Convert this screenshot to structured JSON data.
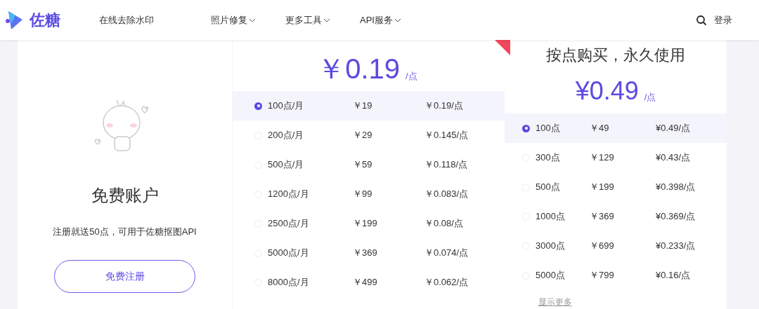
{
  "header": {
    "brand": "佐糖",
    "nav": [
      {
        "label": "在线去除水印",
        "dropdown": false
      },
      {
        "label": "照片修复",
        "dropdown": true
      },
      {
        "label": "更多工具",
        "dropdown": true
      },
      {
        "label": "API服务",
        "dropdown": true
      }
    ],
    "login": "登录"
  },
  "free_card": {
    "title": "免费账户",
    "description": "注册就送50点，可用于佐糖抠图API",
    "button": "免费注册"
  },
  "monthly_card": {
    "price": "￥0.19",
    "unit": "/点",
    "rows": [
      {
        "points": "100点/月",
        "price": "￥19",
        "per_point": "￥0.19/点",
        "selected": true
      },
      {
        "points": "200点/月",
        "price": "￥29",
        "per_point": "￥0.145/点",
        "selected": false
      },
      {
        "points": "500点/月",
        "price": "￥59",
        "per_point": "￥0.118/点",
        "selected": false
      },
      {
        "points": "1200点/月",
        "price": "￥99",
        "per_point": "￥0.083/点",
        "selected": false
      },
      {
        "points": "2500点/月",
        "price": "￥199",
        "per_point": "￥0.08/点",
        "selected": false
      },
      {
        "points": "5000点/月",
        "price": "￥369",
        "per_point": "￥0.074/点",
        "selected": false
      },
      {
        "points": "8000点/月",
        "price": "￥499",
        "per_point": "￥0.062/点",
        "selected": false
      }
    ]
  },
  "pay_card": {
    "title": "按点购买，永久使用",
    "price": "¥0.49",
    "unit": "/点",
    "rows": [
      {
        "points": "100点",
        "price": "￥49",
        "per_point": "¥0.49/点",
        "selected": true
      },
      {
        "points": "300点",
        "price": "￥129",
        "per_point": "¥0.43/点",
        "selected": false
      },
      {
        "points": "500点",
        "price": "￥199",
        "per_point": "¥0.398/点",
        "selected": false
      },
      {
        "points": "1000点",
        "price": "￥369",
        "per_point": "¥0.369/点",
        "selected": false
      },
      {
        "points": "3000点",
        "price": "￥699",
        "per_point": "¥0.233/点",
        "selected": false
      },
      {
        "points": "5000点",
        "price": "￥799",
        "per_point": "¥0.16/点",
        "selected": false
      }
    ],
    "more": "显示更多"
  }
}
